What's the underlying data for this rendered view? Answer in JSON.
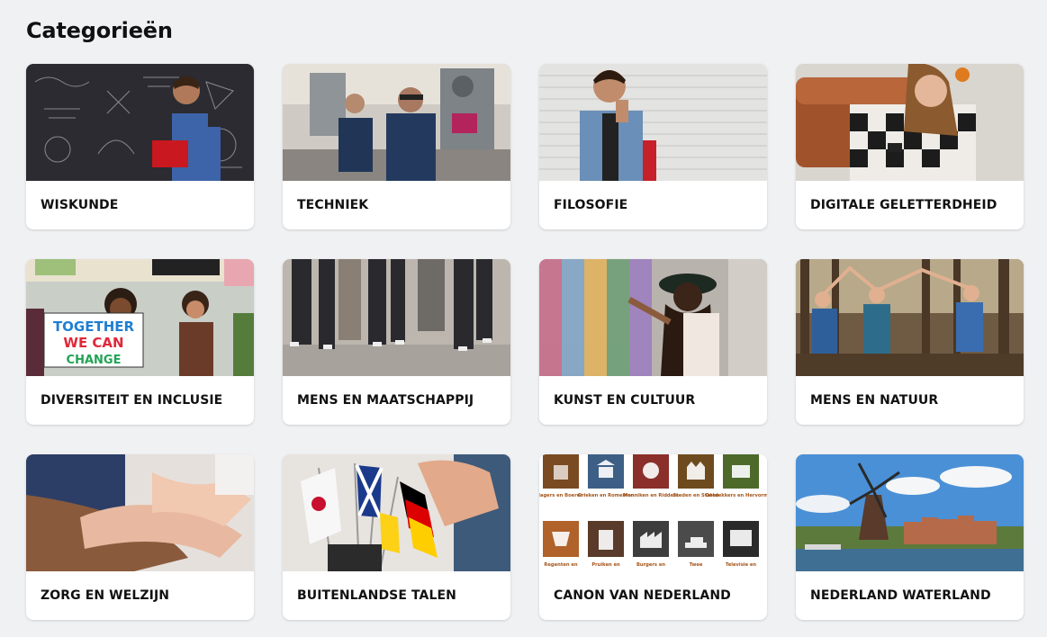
{
  "page": {
    "title": "Categorieën"
  },
  "categories": [
    {
      "label": "WISKUNDE",
      "image": "student-with-math-chalkboard"
    },
    {
      "label": "TECHNIEK",
      "image": "students-in-workshop"
    },
    {
      "label": "FILOSOFIE",
      "image": "thinking-boy-at-brick-wall"
    },
    {
      "label": "DIGITALE GELETTERDHEID",
      "image": "girl-with-smartphone-on-sofa"
    },
    {
      "label": "DIVERSITEIT EN INCLUSIE",
      "image": "protest-with-signs",
      "sign_lines": [
        "TOGETHER",
        "WE CAN",
        "CHANGE"
      ]
    },
    {
      "label": "MENS EN MAATSCHAPPIJ",
      "image": "people-walking-on-street"
    },
    {
      "label": "KUNST EN CULTUUR",
      "image": "woman-painting-mural"
    },
    {
      "label": "MENS EN NATUUR",
      "image": "hikers-in-forest"
    },
    {
      "label": "ZORG EN WELZIJN",
      "image": "holding-hands"
    },
    {
      "label": "BUITENLANDSE TALEN",
      "image": "flags-in-pen-holder"
    },
    {
      "label": "CANON VAN NEDERLAND",
      "image": "canon-era-icons",
      "canon_captions": [
        "Jagers en Boeren",
        "Grieken en Romeinen",
        "Monniken en Ridders",
        "Steden en Staten",
        "Ontdekkers en Hervormers",
        "Regenten en",
        "Pruiken en",
        "Burgers en",
        "Twee",
        "Televisie en"
      ]
    },
    {
      "label": "NEDERLAND WATERLAND",
      "image": "windmill-by-canal"
    }
  ],
  "colors": {
    "background": "#f0f1f3",
    "card": "#ffffff",
    "text": "#111111",
    "canon_brown": "#7a4a22",
    "canon_orange": "#b0622a"
  }
}
